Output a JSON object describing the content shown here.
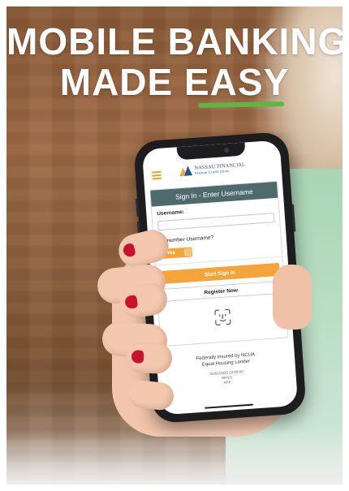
{
  "headline": {
    "line1": "MOBILE BANKING",
    "line2_prefix": "MADE ",
    "line2_emphasis": "EASY",
    "underline_color": "#5fb645"
  },
  "phone_app": {
    "header": {
      "menu_icon": "hamburger-menu-icon",
      "logo_name": "NASSAU FINANCIAL",
      "logo_tagline": "Federal Credit Union"
    },
    "signin_card": {
      "title": "Sign In - Enter Username",
      "username_label": "Username:",
      "username_value": "",
      "remember_label": "Remember Username?",
      "remember_toggle_label": "Yes",
      "remember_toggle_on": true,
      "start_button": "Start Sign In",
      "register_button": "Register Now",
      "faceid_icon": "face-id-icon"
    },
    "footer": {
      "line1": "Federally insured by NCUA",
      "line2": "Equal Housing Lender",
      "timestamp": "04/01/2020 10:00:00",
      "code1": "WHD1",
      "code2": "APP"
    }
  },
  "colors": {
    "accent": "#f4a43a",
    "card_header": "#4f6a6d",
    "brand_blue": "#2a4e8c"
  }
}
